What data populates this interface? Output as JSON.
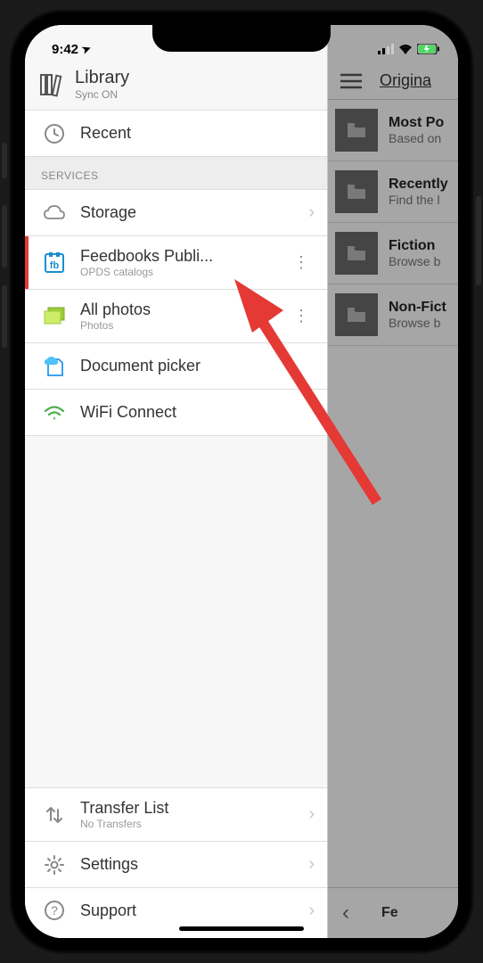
{
  "status_bar": {
    "time": "9:42",
    "location_icon": "➤"
  },
  "sidebar": {
    "header": {
      "title": "Library",
      "subtitle": "Sync ON"
    },
    "recent": {
      "label": "Recent"
    },
    "section_label": "SERVICES",
    "services": [
      {
        "label": "Storage",
        "icon": "cloud",
        "has_chevron": true
      },
      {
        "label": "Feedbooks Publi...",
        "sublabel": "OPDS catalogs",
        "icon": "fb",
        "has_kebab": true,
        "highlighted": true
      },
      {
        "label": "All photos",
        "sublabel": "Photos",
        "icon": "photos",
        "has_kebab": true
      },
      {
        "label": "Document picker",
        "icon": "docpicker"
      },
      {
        "label": "WiFi Connect",
        "icon": "wifi"
      }
    ],
    "bottom": [
      {
        "label": "Transfer List",
        "sublabel": "No Transfers",
        "icon": "transfer",
        "has_chevron": true
      },
      {
        "label": "Settings",
        "icon": "gear",
        "has_chevron": true
      },
      {
        "label": "Support",
        "icon": "help",
        "has_chevron": true
      }
    ]
  },
  "main": {
    "header_title": "Origina",
    "items": [
      {
        "title": "Most Po",
        "subtitle": "Based on"
      },
      {
        "title": "Recently",
        "subtitle": "Find the l"
      },
      {
        "title": "Fiction",
        "subtitle": "Browse b"
      },
      {
        "title": "Non-Fict",
        "subtitle": "Browse b"
      }
    ],
    "bottom_text": "Fe"
  }
}
